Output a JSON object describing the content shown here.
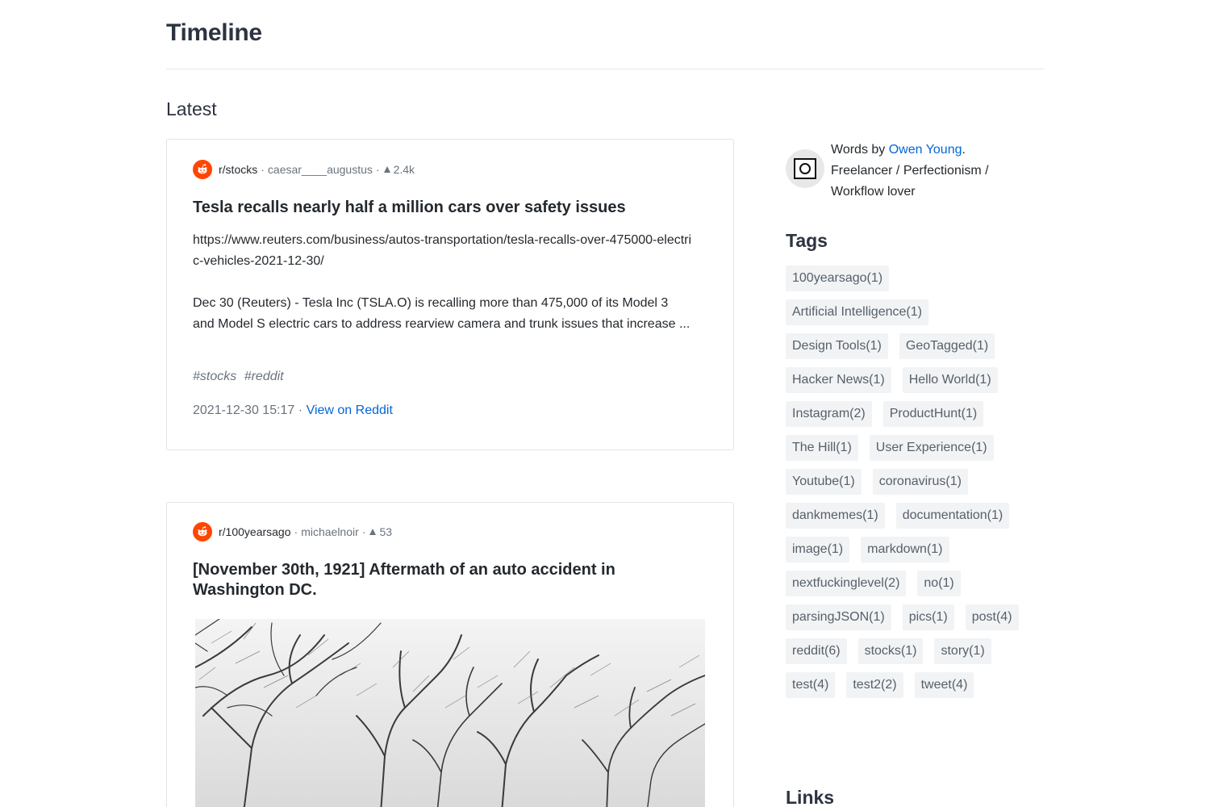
{
  "page": {
    "title": "Timeline",
    "section_title": "Latest"
  },
  "posts": [
    {
      "subreddit": "r/stocks",
      "author": "caesar____augustus",
      "score": "2.4k",
      "title": "Tesla recalls nearly half a million cars over safety issues",
      "body_url": "https://www.reuters.com/business/autos-transportation/tesla-recalls-over-475000-electric-vehicles-2021-12-30/",
      "body_text": "Dec 30 (Reuters) - Tesla Inc (TSLA.O) is recalling more than 475,000 of its Model 3 and Model S electric cars to address rearview camera and trunk issues that increase ...",
      "hashtags": [
        "#stocks",
        "#reddit"
      ],
      "timestamp": "2021-12-30 15:17",
      "view_link": "View on Reddit"
    },
    {
      "subreddit": "r/100yearsago",
      "author": "michaelnoir",
      "score": "53",
      "title": "[November 30th, 1921] Aftermath of an auto accident in Washington DC."
    }
  ],
  "sidebar": {
    "author": {
      "prefix": "Words by ",
      "name": "Owen Young",
      "suffix": ".",
      "bio": "Freelancer / Perfectionism / Workflow lover"
    },
    "tags_heading": "Tags",
    "tags": [
      "100yearsago(1)",
      "Artificial Intelligence(1)",
      "Design Tools(1)",
      "GeoTagged(1)",
      "Hacker News(1)",
      "Hello World(1)",
      "Instagram(2)",
      "ProductHunt(1)",
      "The Hill(1)",
      "User Experience(1)",
      "Youtube(1)",
      "coronavirus(1)",
      "dankmemes(1)",
      "documentation(1)",
      "image(1)",
      "markdown(1)",
      "nextfuckinglevel(2)",
      "no(1)",
      "parsingJSON(1)",
      "pics(1)",
      "post(4)",
      "reddit(6)",
      "stocks(1)",
      "story(1)",
      "test(4)",
      "test2(2)",
      "tweet(4)"
    ],
    "links_heading": "Links"
  },
  "colors": {
    "reddit_orange": "#ff4500",
    "link_blue": "#0366d6",
    "tag_bg": "#f1f3f5"
  }
}
